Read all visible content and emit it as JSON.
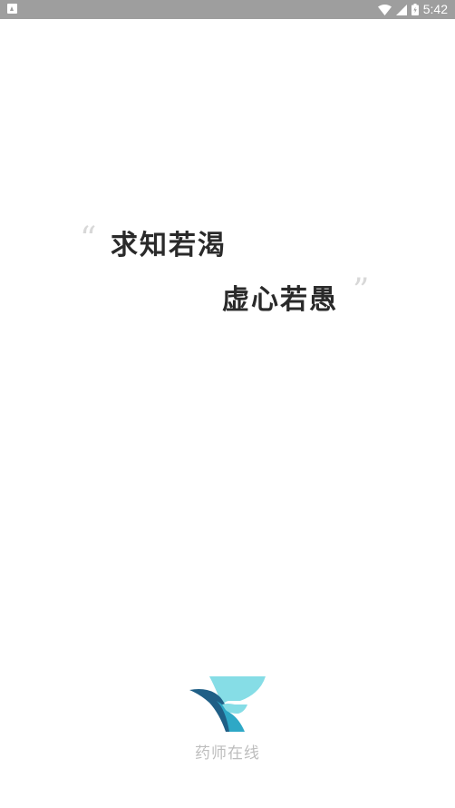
{
  "status_bar": {
    "time": "5:42",
    "icons": [
      "notification-icon",
      "wifi-icon",
      "cell-signal-icon",
      "battery-icon"
    ],
    "background_color": "#9e9e9e"
  },
  "splash": {
    "quote_open": "“",
    "quote_close": "”",
    "slogan_line_1": "求知若渴",
    "slogan_line_2": "虚心若愚"
  },
  "brand": {
    "name": "药师在线",
    "logo_icon": "pharmacist-online-logo-icon",
    "colors": [
      "#1f5f86",
      "#2ea8c6",
      "#86dde6"
    ]
  }
}
